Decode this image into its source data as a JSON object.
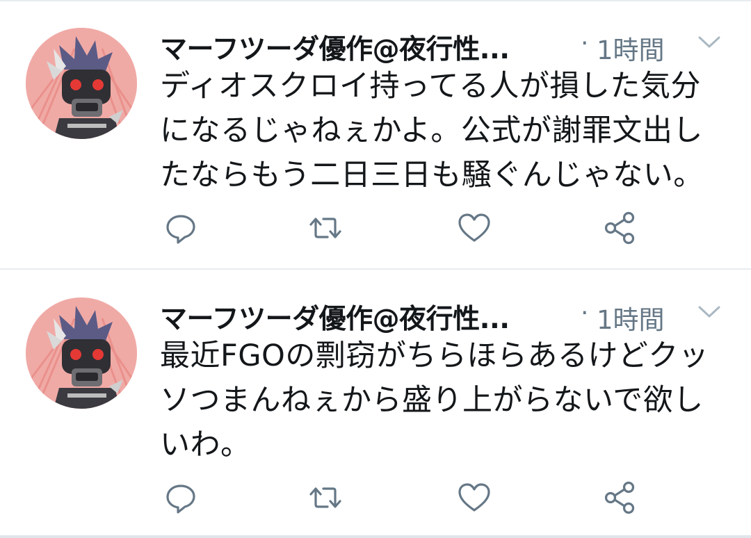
{
  "colors": {
    "text": "#14171a",
    "secondary": "#657786",
    "divider": "#e6ecf0"
  },
  "tweets": [
    {
      "display_name": "マーフツーダ優作@夜行性...",
      "separator": "·",
      "time": "1時間",
      "text": "ディオスクロイ持ってる人が損した気分になるじゃねぇかよ。公式が謝罪文出したならもう二日三日も騒ぐんじゃない。",
      "icons": [
        "reply-icon",
        "retweet-icon",
        "like-icon",
        "share-icon"
      ]
    },
    {
      "display_name": "マーフツーダ優作@夜行性...",
      "separator": "·",
      "time": "1時間",
      "text": "最近FGOの剽窃がちらほらあるけどクッソつまんねぇから盛り上がらないで欲しいわ。",
      "icons": [
        "reply-icon",
        "retweet-icon",
        "like-icon",
        "share-icon"
      ]
    }
  ]
}
